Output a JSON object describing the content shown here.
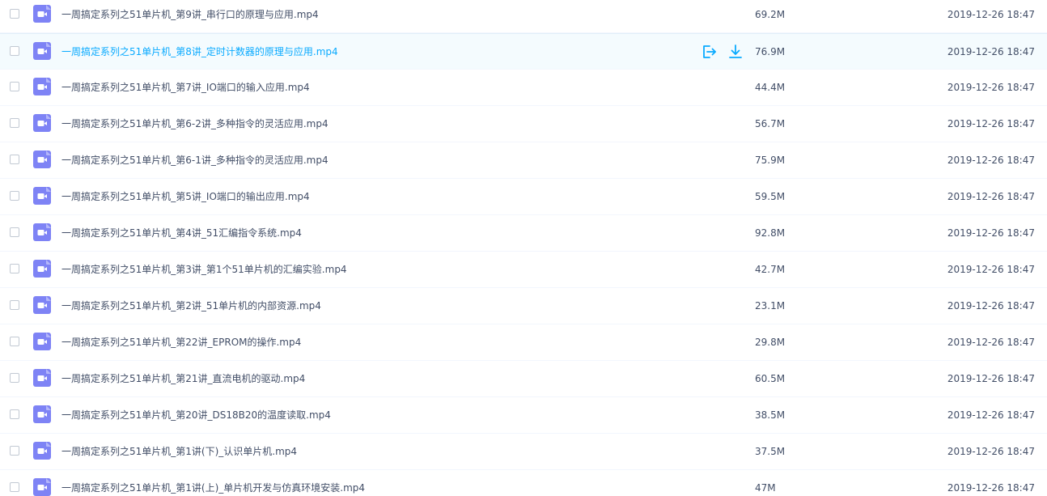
{
  "colors": {
    "icon_bg": "#7e83f5",
    "hover_text": "#09aaff",
    "text": "#424e67"
  },
  "file_icon": "video-file-icon",
  "row_actions": {
    "share_icon": "share-icon",
    "download_icon": "download-icon"
  },
  "files": [
    {
      "name": "一周搞定系列之51单片机_第9讲_串行口的原理与应用.mp4",
      "size": "69.2M",
      "date": "2019-12-26 18:47"
    },
    {
      "name": "一周搞定系列之51单片机_第8讲_定时计数器的原理与应用.mp4",
      "size": "76.9M",
      "date": "2019-12-26 18:47",
      "hover": true
    },
    {
      "name": "一周搞定系列之51单片机_第7讲_IO端口的输入应用.mp4",
      "size": "44.4M",
      "date": "2019-12-26 18:47"
    },
    {
      "name": "一周搞定系列之51单片机_第6-2讲_多种指令的灵活应用.mp4",
      "size": "56.7M",
      "date": "2019-12-26 18:47"
    },
    {
      "name": "一周搞定系列之51单片机_第6-1讲_多种指令的灵活应用.mp4",
      "size": "75.9M",
      "date": "2019-12-26 18:47"
    },
    {
      "name": "一周搞定系列之51单片机_第5讲_IO端口的输出应用.mp4",
      "size": "59.5M",
      "date": "2019-12-26 18:47"
    },
    {
      "name": "一周搞定系列之51单片机_第4讲_51汇编指令系统.mp4",
      "size": "92.8M",
      "date": "2019-12-26 18:47"
    },
    {
      "name": "一周搞定系列之51单片机_第3讲_第1个51单片机的汇编实验.mp4",
      "size": "42.7M",
      "date": "2019-12-26 18:47"
    },
    {
      "name": "一周搞定系列之51单片机_第2讲_51单片机的内部资源.mp4",
      "size": "23.1M",
      "date": "2019-12-26 18:47"
    },
    {
      "name": "一周搞定系列之51单片机_第22讲_EPROM的操作.mp4",
      "size": "29.8M",
      "date": "2019-12-26 18:47"
    },
    {
      "name": "一周搞定系列之51单片机_第21讲_直流电机的驱动.mp4",
      "size": "60.5M",
      "date": "2019-12-26 18:47"
    },
    {
      "name": "一周搞定系列之51单片机_第20讲_DS18B20的温度读取.mp4",
      "size": "38.5M",
      "date": "2019-12-26 18:47"
    },
    {
      "name": "一周搞定系列之51单片机_第1讲(下)_认识单片机.mp4",
      "size": "37.5M",
      "date": "2019-12-26 18:47"
    },
    {
      "name": "一周搞定系列之51单片机_第1讲(上)_单片机开发与仿真环境安装.mp4",
      "size": "47M",
      "date": "2019-12-26 18:47"
    }
  ]
}
